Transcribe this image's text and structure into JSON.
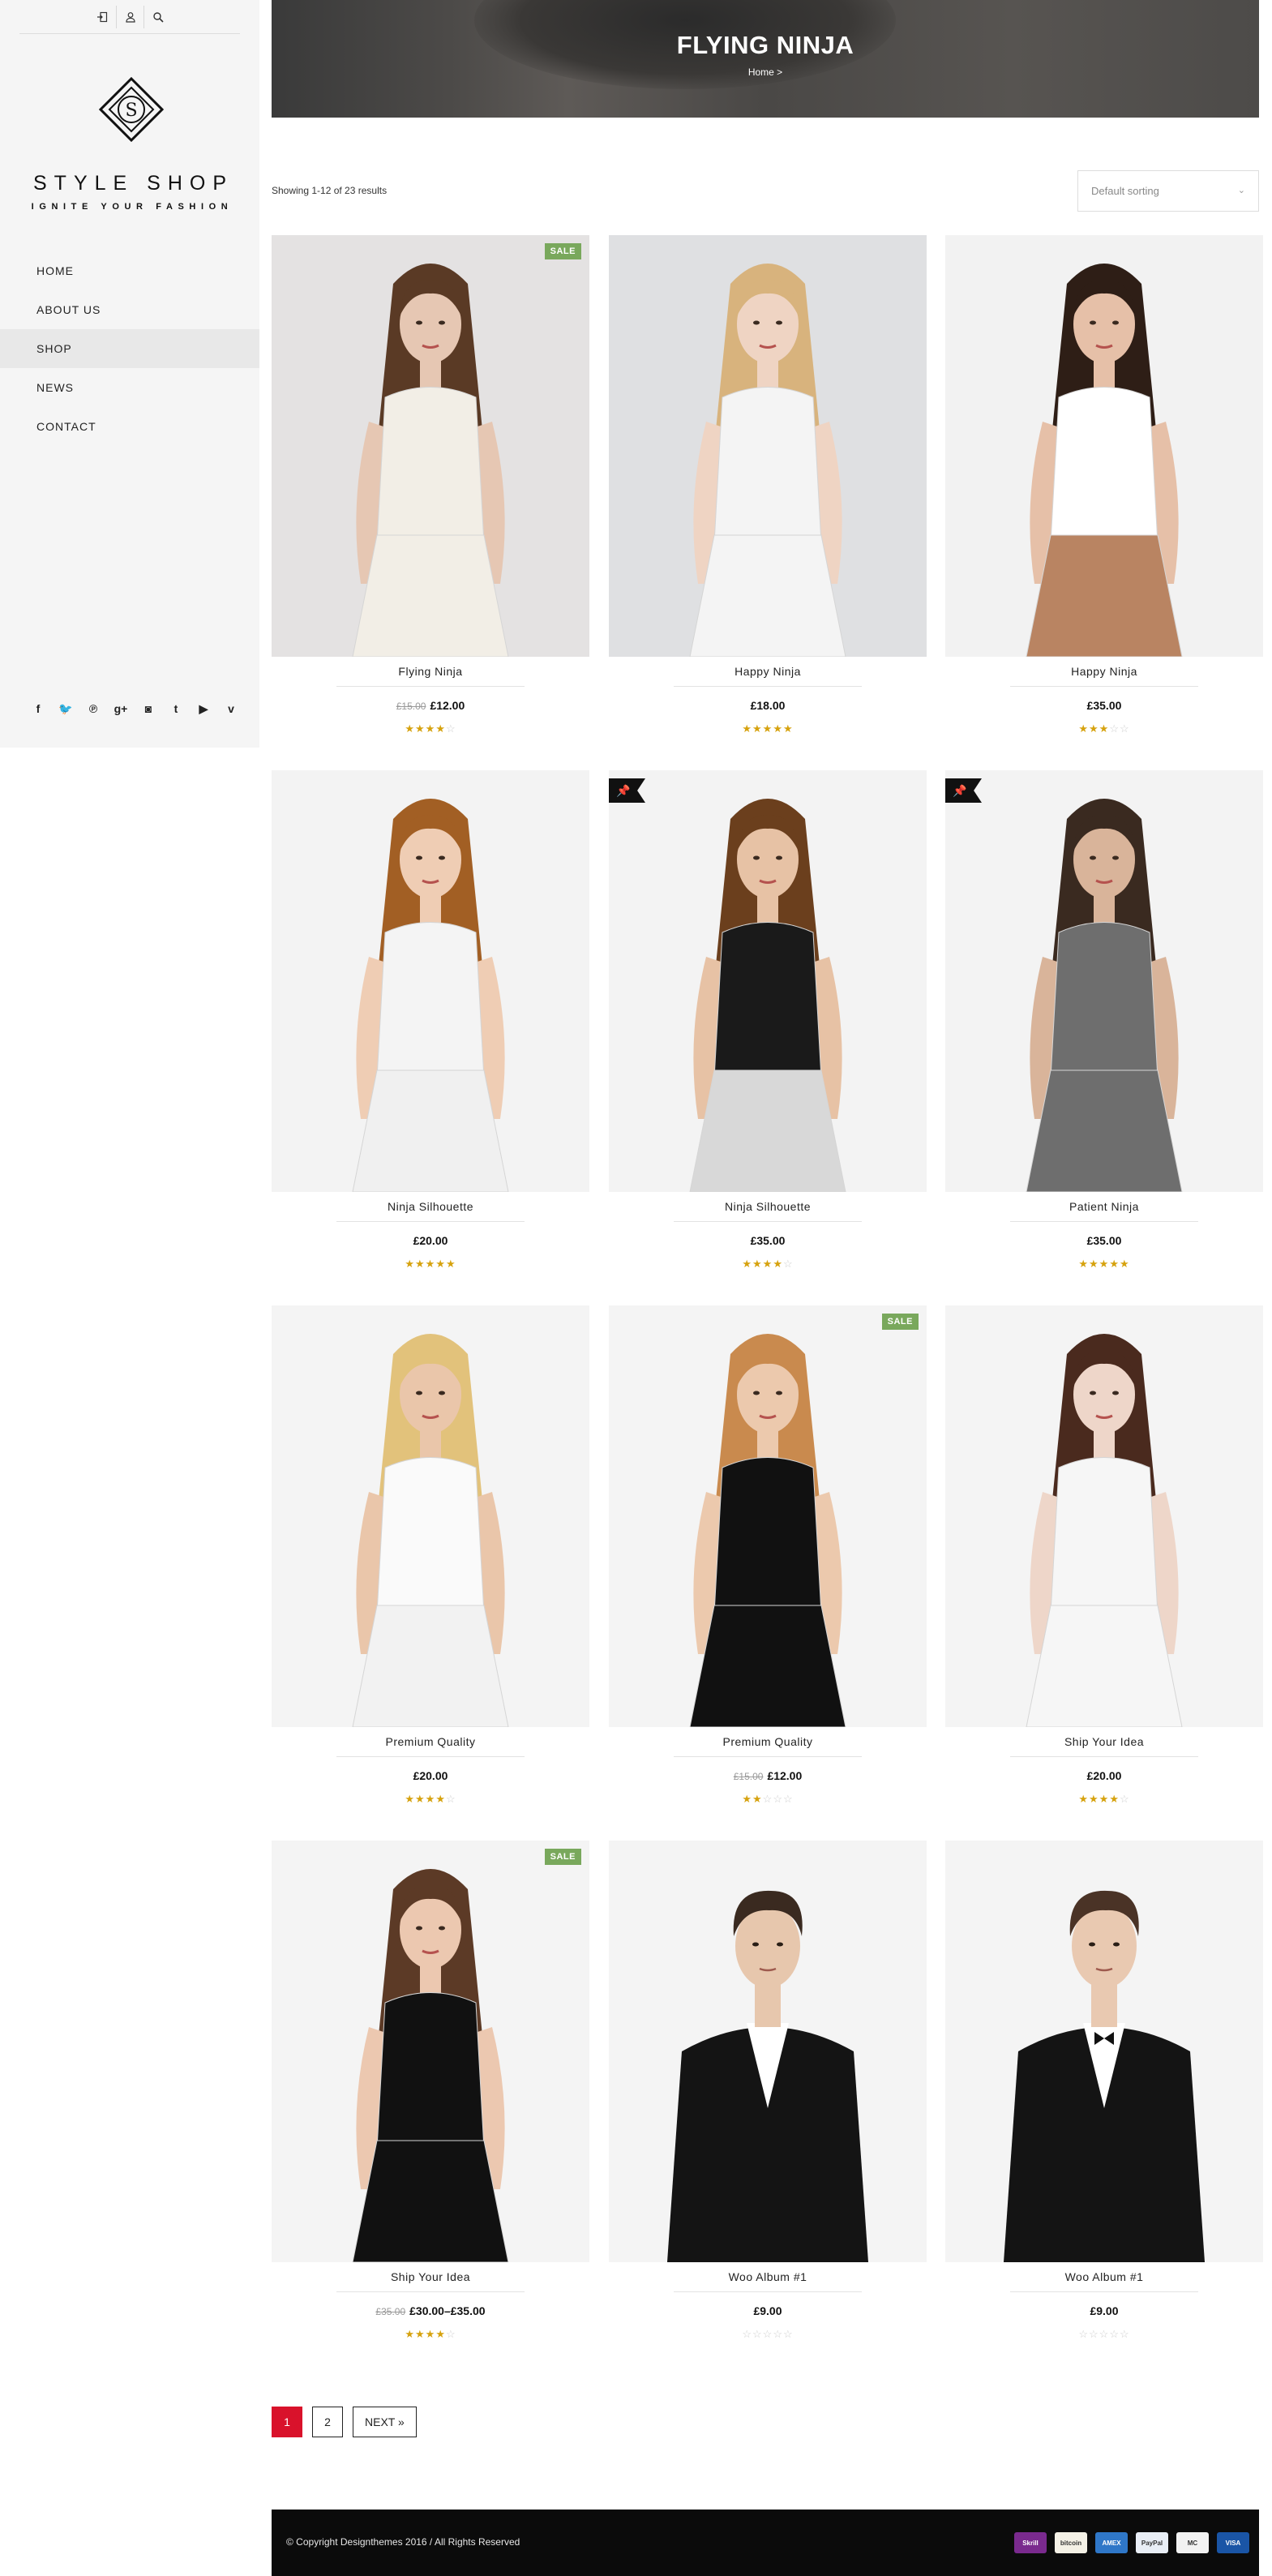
{
  "sidebar": {
    "top_icons": [
      "login-icon",
      "user-icon",
      "search-icon"
    ],
    "brand": "STYLE SHOP",
    "tagline": "IGNITE YOUR FASHION",
    "logo_letter": "S",
    "menu": [
      {
        "label": "HOME",
        "active": false
      },
      {
        "label": "ABOUT US",
        "active": false
      },
      {
        "label": "SHOP",
        "active": true
      },
      {
        "label": "NEWS",
        "active": false
      },
      {
        "label": "CONTACT",
        "active": false
      }
    ],
    "social": [
      {
        "icon": "facebook-icon",
        "glyph": "f"
      },
      {
        "icon": "twitter-icon",
        "glyph": "🐦"
      },
      {
        "icon": "pinterest-icon",
        "glyph": "℗"
      },
      {
        "icon": "google-plus-icon",
        "glyph": "g+"
      },
      {
        "icon": "instagram-icon",
        "glyph": "◙"
      },
      {
        "icon": "tumblr-icon",
        "glyph": "t"
      },
      {
        "icon": "youtube-icon",
        "glyph": "▶"
      },
      {
        "icon": "vimeo-icon",
        "glyph": "v"
      }
    ]
  },
  "hero": {
    "title": "FLYING NINJA",
    "breadcrumb": "Home >"
  },
  "shop": {
    "results_text": "Showing 1-12 of 23 results",
    "sorting": "Default sorting"
  },
  "products": [
    {
      "name": "Flying Ninja",
      "old_price": "£15.00",
      "price": "£12.00",
      "rating": 4,
      "badge": "SALE",
      "pin": false,
      "palette": {
        "bg": "#e4e2e2",
        "skin": "#e6c7b3",
        "hair": "#5a3a25",
        "top": "#f2eee6",
        "bottom": "#f2eee6"
      }
    },
    {
      "name": "Happy Ninja",
      "old_price": "",
      "price": "£18.00",
      "rating": 5,
      "badge": "",
      "pin": false,
      "palette": {
        "bg": "#dfe0e2",
        "skin": "#efd4c3",
        "hair": "#d8b37d",
        "top": "#f4f4f4",
        "bottom": "#f4f4f4"
      }
    },
    {
      "name": "Happy Ninja",
      "old_price": "",
      "price": "£35.00",
      "rating": 3,
      "badge": "",
      "pin": false,
      "palette": {
        "bg": "#f2f2f2",
        "skin": "#e6c0a8",
        "hair": "#2e1e16",
        "top": "#ffffff",
        "bottom": "#b98462"
      }
    },
    {
      "name": "Ninja Silhouette",
      "old_price": "",
      "price": "£20.00",
      "rating": 5,
      "badge": "",
      "pin": false,
      "palette": {
        "bg": "#f3f3f3",
        "skin": "#efcdb4",
        "hair": "#a25f24",
        "top": "#f4f4f4",
        "bottom": "#f0f0f0"
      }
    },
    {
      "name": "Ninja Silhouette",
      "old_price": "",
      "price": "£35.00",
      "rating": 4,
      "badge": "",
      "pin": true,
      "palette": {
        "bg": "#f3f3f3",
        "skin": "#e7c2a5",
        "hair": "#6b3f1d",
        "top": "#1a1a1a",
        "bottom": "#d8d8d8"
      }
    },
    {
      "name": "Patient Ninja",
      "old_price": "",
      "price": "£35.00",
      "rating": 5,
      "badge": "",
      "pin": true,
      "palette": {
        "bg": "#f3f3f3",
        "skin": "#d9b49a",
        "hair": "#3a2a20",
        "top": "#6e6e6e",
        "bottom": "#6e6e6e"
      }
    },
    {
      "name": "Premium Quality",
      "old_price": "",
      "price": "£20.00",
      "rating": 4,
      "badge": "",
      "pin": false,
      "palette": {
        "bg": "#f4f4f4",
        "skin": "#eac6aa",
        "hair": "#e2c27b",
        "top": "#fafafa",
        "bottom": "#f2f2f2"
      }
    },
    {
      "name": "Premium Quality",
      "old_price": "£15.00",
      "price": "£12.00",
      "rating": 2,
      "badge": "SALE",
      "pin": false,
      "palette": {
        "bg": "#f4f4f4",
        "skin": "#ecc9ad",
        "hair": "#c98a4e",
        "top": "#111111",
        "bottom": "#111111"
      }
    },
    {
      "name": "Ship Your Idea",
      "old_price": "",
      "price": "£20.00",
      "rating": 4,
      "badge": "",
      "pin": false,
      "palette": {
        "bg": "#f4f4f4",
        "skin": "#eed6c9",
        "hair": "#4a2a1e",
        "top": "#f6f6f6",
        "bottom": "#f6f6f6"
      }
    },
    {
      "name": "Ship Your Idea",
      "old_price": "£35.00",
      "price": "£30.00–£35.00",
      "rating": 4,
      "badge": "SALE",
      "pin": false,
      "palette": {
        "bg": "#f4f4f4",
        "skin": "#ecc8b0",
        "hair": "#5c3a26",
        "top": "#111111",
        "bottom": "#111111"
      }
    },
    {
      "name": "Woo Album #1",
      "old_price": "",
      "price": "£9.00",
      "rating": 0,
      "badge": "",
      "pin": false,
      "palette": {
        "bg": "#f4f4f4",
        "skin": "#e7c7ad",
        "hair": "#3a2a20",
        "top": "#141414",
        "bottom": "#141414"
      }
    },
    {
      "name": "Woo Album #1",
      "old_price": "",
      "price": "£9.00",
      "rating": 0,
      "badge": "",
      "pin": false,
      "palette": {
        "bg": "#f4f4f4",
        "skin": "#e9c9b1",
        "hair": "#4a3326",
        "top": "#141414",
        "bottom": "#141414"
      }
    }
  ],
  "pagination": {
    "pages": [
      "1",
      "2"
    ],
    "current": "1",
    "next": "NEXT »"
  },
  "footer": {
    "copyright": "© Copyright Designthemes 2016 / All Rights Reserved",
    "payments": [
      {
        "label": "Skrill",
        "color": "#7a2a8e"
      },
      {
        "label": "bitcoin",
        "color": "#f4f1e6"
      },
      {
        "label": "AMEX",
        "color": "#2f77c8"
      },
      {
        "label": "PayPal",
        "color": "#e9eef6"
      },
      {
        "label": "MC",
        "color": "#f2f2f2"
      },
      {
        "label": "VISA",
        "color": "#1a55a6"
      }
    ]
  }
}
